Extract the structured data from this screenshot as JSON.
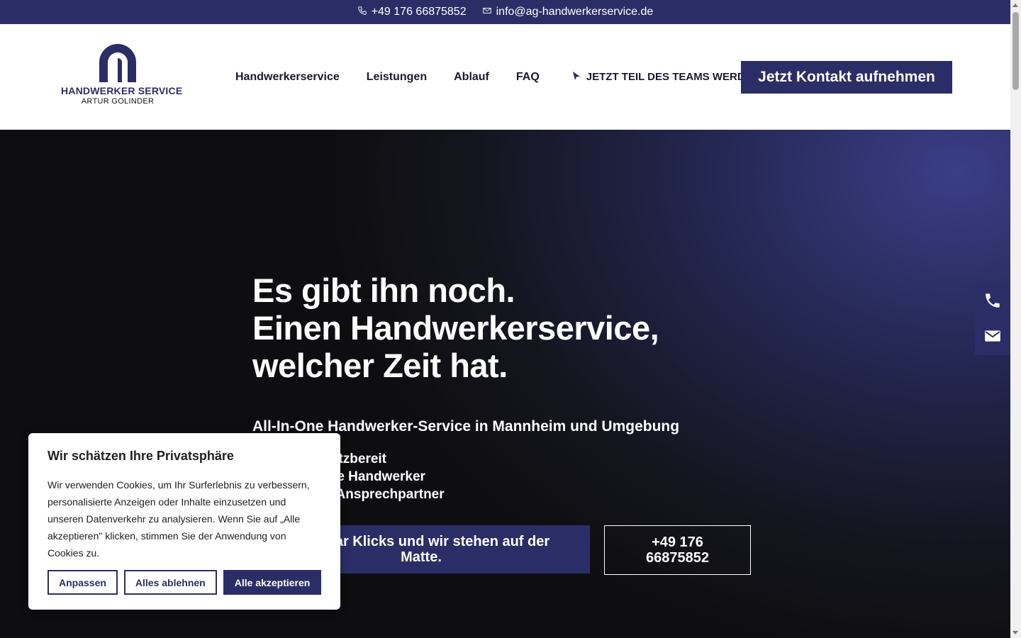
{
  "topbar": {
    "phone": "+49 176 66875852",
    "email": "info@ag-handwerkerservice.de"
  },
  "header": {
    "logo": {
      "brand": "HANDWERKER SERVICE",
      "owner": "ARTUR GOLINDER"
    },
    "nav": [
      "Handwerkerservice",
      "Leistungen",
      "Ablauf",
      "FAQ"
    ],
    "team_link": "JETZT TEIL DES TEAMS WERDEN",
    "cta": "Jetzt Kontakt aufnehmen"
  },
  "hero": {
    "title": [
      "Es gibt ihn noch.",
      "Einen Handwerkerservice,",
      "welcher Zeit hat."
    ],
    "subtitle": "All-In-One Handwerker-Service in Mannheim und Umgebung",
    "list": [
      "Schnell einsatzbereit",
      "Professionelle Handwerker",
      "Einen festen Ansprechpartner"
    ],
    "primary_button": "Ein paar Klicks und wir stehen auf der Matte.",
    "phone_button": "+49 176 66875852"
  },
  "cookie": {
    "title": "Wir schätzen Ihre Privatsphäre",
    "text": "Wir verwenden Cookies, um Ihr Surferlebnis zu verbessern, personalisierte Anzeigen oder Inhalte einzusetzen und unseren Datenverkehr zu analysieren. Wenn Sie auf „Alle akzeptieren\" klicken, stimmen Sie der Anwendung von Cookies zu.",
    "customize": "Anpassen",
    "reject": "Alles ablehnen",
    "accept": "Alle akzeptieren"
  },
  "colors": {
    "brand": "#2b2e66",
    "topbar": "#2b2e66",
    "hero_dark": "#0e0e10"
  },
  "icons": {
    "topbar_phone": "phone-icon",
    "topbar_email": "mail-icon",
    "team": "cursor-icon",
    "float_phone": "phone-icon",
    "float_email": "envelope-icon"
  }
}
